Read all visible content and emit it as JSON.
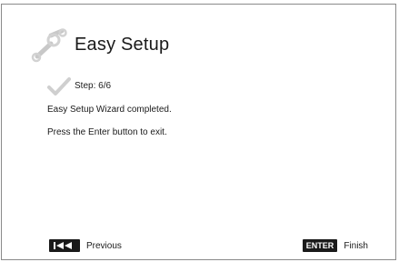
{
  "header": {
    "title": "Easy Setup",
    "icon": "wrench-icon"
  },
  "step": {
    "label": "Step: 6/6",
    "icon": "checkmark-icon"
  },
  "messages": {
    "line1": "Easy Setup Wizard completed.",
    "line2": "Press the Enter button to exit."
  },
  "footer": {
    "previous_key_icon": "skip-back-icon",
    "previous_label": "Previous",
    "enter_key_label": "ENTER",
    "finish_label": "Finish"
  },
  "colors": {
    "keycap_bg": "#1a1a1a",
    "icon_gray": "#c8c8c8",
    "border": "#8a8a8a"
  }
}
